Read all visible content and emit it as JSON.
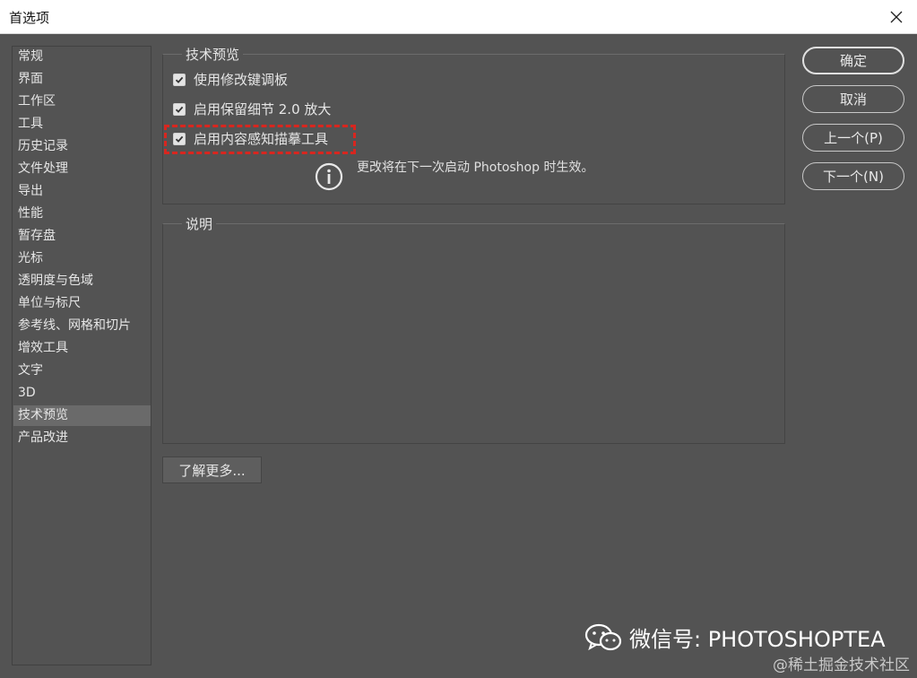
{
  "window": {
    "title": "首选项"
  },
  "sidebar": {
    "items": [
      {
        "label": "常规"
      },
      {
        "label": "界面"
      },
      {
        "label": "工作区"
      },
      {
        "label": "工具"
      },
      {
        "label": "历史记录"
      },
      {
        "label": "文件处理"
      },
      {
        "label": "导出"
      },
      {
        "label": "性能"
      },
      {
        "label": "暂存盘"
      },
      {
        "label": "光标"
      },
      {
        "label": "透明度与色域"
      },
      {
        "label": "单位与标尺"
      },
      {
        "label": "参考线、网格和切片"
      },
      {
        "label": "增效工具"
      },
      {
        "label": "文字"
      },
      {
        "label": "3D"
      },
      {
        "label": "技术预览",
        "active": true
      },
      {
        "label": "产品改进"
      }
    ]
  },
  "tech_preview": {
    "legend": "技术预览",
    "options": [
      {
        "label": "使用修改键调板",
        "checked": true
      },
      {
        "label": "启用保留细节 2.0 放大",
        "checked": true
      },
      {
        "label": "启用内容感知描摹工具",
        "checked": true
      }
    ],
    "restart_note": "更改将在下一次启动 Photoshop 时生效。"
  },
  "description": {
    "legend": "说明"
  },
  "learn_more": "了解更多...",
  "buttons": {
    "ok": "确定",
    "cancel": "取消",
    "prev": "上一个(P)",
    "next": "下一个(N)"
  },
  "watermark": {
    "wechat_text": "微信号: PHOTOSHOPTEA",
    "footer": "@稀土掘金技术社区"
  },
  "colors": {
    "background": "#535353",
    "highlight": "#d8261f"
  }
}
